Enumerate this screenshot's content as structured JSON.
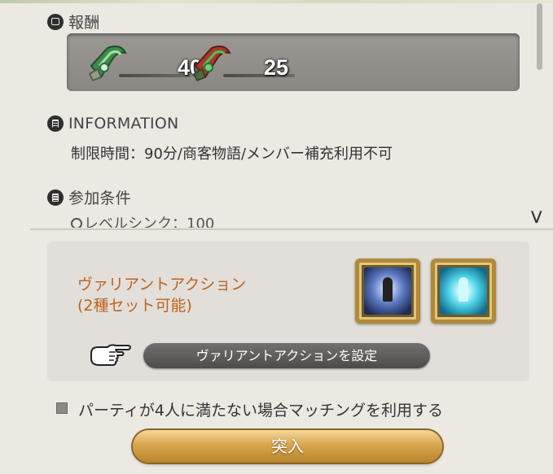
{
  "rewards": {
    "title": "報酬",
    "items": [
      {
        "icon": "green-tomestone-icon",
        "count": "40"
      },
      {
        "icon": "red-tomestone-icon",
        "count": "25"
      }
    ]
  },
  "information": {
    "title": "INFORMATION",
    "text": "制限時間：90分/商客物語/メンバー補充利用不可"
  },
  "requirements": {
    "title": "参加条件",
    "partial_text": "レベルシンク：100"
  },
  "variant": {
    "title_line1": "ヴァリアントアクション",
    "title_line2": "(2種セット可能)",
    "set_button": "ヴァリアントアクションを設定",
    "actions": [
      "variant-action-1-icon",
      "variant-action-2-icon"
    ]
  },
  "matching": {
    "label": "パーティが4人に満たない場合マッチングを利用する",
    "checked": false
  },
  "enter_button": "突入",
  "colors": {
    "accent_orange": "#c0621a",
    "panel_bg": "#ece9e3",
    "button_gold": "#d9a651"
  }
}
